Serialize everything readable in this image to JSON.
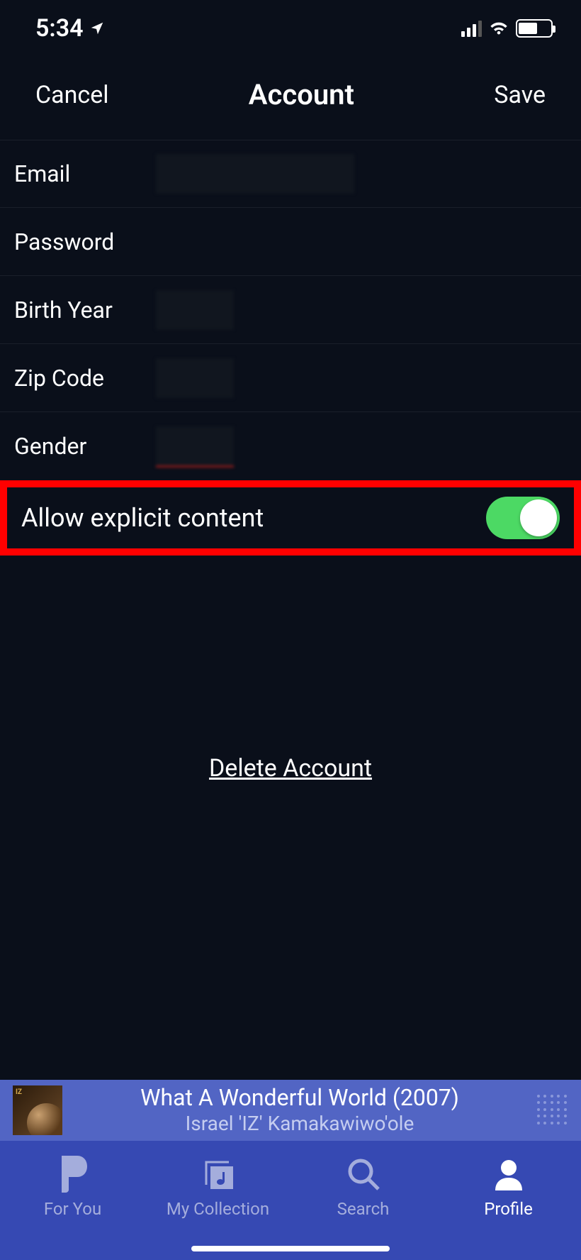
{
  "statusbar": {
    "time": "5:34"
  },
  "header": {
    "cancel": "Cancel",
    "title": "Account",
    "save": "Save"
  },
  "rows": {
    "email": "Email",
    "password": "Password",
    "birth_year": "Birth Year",
    "zip_code": "Zip Code",
    "gender": "Gender",
    "explicit": "Allow explicit content"
  },
  "toggle": {
    "explicit_on": true
  },
  "delete_link": "Delete Account",
  "now_playing": {
    "title": "What A Wonderful World (2007)",
    "artist": "Israel 'IZ' Kamakawiwo'ole"
  },
  "tabs": {
    "for_you": "For You",
    "my_collection": "My Collection",
    "search": "Search",
    "profile": "Profile"
  }
}
